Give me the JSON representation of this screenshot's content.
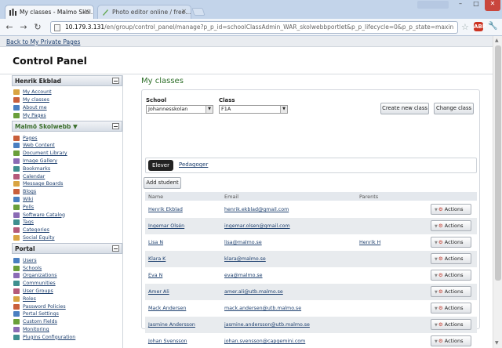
{
  "browser": {
    "tabs": [
      {
        "title": "My classes - Malmo Skol...",
        "active": true
      },
      {
        "title": "Photo editor online / free...",
        "active": false
      }
    ],
    "user_label": "",
    "url_host": "10.179.3.131",
    "url_path": "/en/group/control_panel/manage?p_p_id=schoolClassAdmin_WAR_skolwebbportlet&p_p_lifecycle=0&p_p_state=maxin"
  },
  "page": {
    "back_link": "Back to My Private Pages",
    "title": "Control Panel"
  },
  "sidebar": {
    "sections": [
      {
        "heading": "Henrik Ekblad",
        "heading_color": "#222222",
        "items": [
          "My Account",
          "My classes",
          "About me",
          "My Pages"
        ]
      },
      {
        "heading": "Malmö Skolwebb ▼",
        "heading_color": "#3b6f2c",
        "items": [
          "Pages",
          "Web Content",
          "Document Library",
          "Image Gallery",
          "Bookmarks",
          "Calendar",
          "Message Boards",
          "Blogs",
          "Wiki",
          "Polls",
          "Software Catalog",
          "Tags",
          "Categories",
          "Social Equity"
        ]
      },
      {
        "heading": "Portal",
        "heading_color": "#222222",
        "items": [
          "Users",
          "Schools",
          "Organizations",
          "Communities",
          "User Groups",
          "Roles",
          "Password Policies",
          "Portal Settings",
          "Custom Fields",
          "Monitoring",
          "Plugins Configuration"
        ]
      }
    ]
  },
  "main": {
    "title": "My classes",
    "school_label": "School",
    "school_value": "Johannesskolan",
    "class_label": "Class",
    "class_value": "F1A",
    "create_class_button": "Create new class",
    "change_class_button": "Change class",
    "tabs": [
      "Elever",
      "Pedagoger"
    ],
    "add_student_button": "Add student",
    "columns": [
      "Name",
      "Email",
      "Parents"
    ],
    "actions_label": "Actions",
    "rows": [
      {
        "name": "Henrik Ekblad",
        "email": "henrik.ekblad@gmail.com",
        "parents": ""
      },
      {
        "name": "Ingemar Olsén",
        "email": "ingemar.olsen@gmail.com",
        "parents": ""
      },
      {
        "name": "Lisa N",
        "email": "lisa@malmo.se",
        "parents": "Henrik H"
      },
      {
        "name": "Klara K",
        "email": "klara@malmo.se",
        "parents": ""
      },
      {
        "name": "Eva N",
        "email": "eva@malmo.se",
        "parents": ""
      },
      {
        "name": "Amer Ali",
        "email": "amer.ali@utb.malmo.se",
        "parents": ""
      },
      {
        "name": "Mack Andersen",
        "email": "mack.andersen@utb.malmo.se",
        "parents": ""
      },
      {
        "name": "Jasmine Andersson",
        "email": "jasmine.andersson@utb.malmo.se",
        "parents": ""
      },
      {
        "name": "Johan Svensson",
        "email": "johan.svensson@capgemini.com",
        "parents": ""
      }
    ]
  },
  "colors": {
    "heading_green": "#2e6f2a",
    "link": "#1d3f6e",
    "row_alt": "#e8ebee"
  },
  "icons": [
    "back-arrow-icon",
    "forward-arrow-icon",
    "reload-icon",
    "star-icon",
    "adblock-icon",
    "wrench-icon",
    "gear-icon",
    "minimize-icon"
  ]
}
